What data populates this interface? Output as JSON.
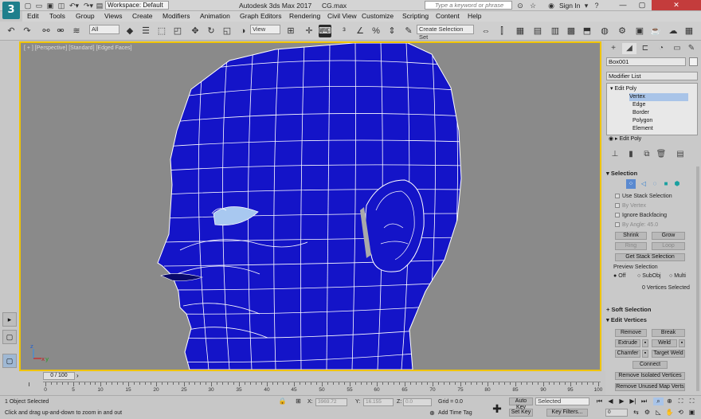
{
  "app": {
    "logo": "3",
    "title": "Autodesk 3ds Max 2017",
    "file": "CG.max",
    "workspace": "Workspace: Default",
    "search_placeholder": "Type a keyword or phrase",
    "sign_in": "Sign In"
  },
  "menu": [
    "Edit",
    "Tools",
    "Group",
    "Views",
    "Create",
    "Modifiers",
    "Animation",
    "Graph Editors",
    "Rendering",
    "Civil View",
    "Customize",
    "Scripting",
    "Content",
    "Help"
  ],
  "toolbar": {
    "filter": "All",
    "refcoord": "View",
    "selset": "Create Selection Set"
  },
  "viewport": {
    "label": "[ + ] [Perspective] [Standard] [Edged Faces]",
    "axis_x": "x",
    "axis_y": "y",
    "axis_z": "z"
  },
  "command_panel": {
    "object_name": "Box001",
    "modifier_list": "Modifier List",
    "stack": [
      {
        "label": "Edit Poly",
        "level": 0
      },
      {
        "label": "Vertex",
        "level": 1
      },
      {
        "label": "Edge",
        "level": 1
      },
      {
        "label": "Border",
        "level": 1
      },
      {
        "label": "Polygon",
        "level": 1
      },
      {
        "label": "Element",
        "level": 1
      },
      {
        "label": "Edit Poly",
        "level": 0
      }
    ],
    "selection": {
      "title": "Selection",
      "use_stack": "Use Stack Selection",
      "by_vertex": "By Vertex",
      "ignore_backfacing": "Ignore Backfacing",
      "by_angle": "By Angle:",
      "angle": "45.0",
      "shrink": "Shrink",
      "grow": "Grow",
      "ring": "Ring",
      "loop": "Loop",
      "get_stack": "Get Stack Selection",
      "preview": "Preview Selection",
      "off": "Off",
      "subobj": "SubObj",
      "multi": "Multi",
      "count": "0 Vertices Selected"
    },
    "soft_selection": "Soft Selection",
    "edit_vertices": {
      "title": "Edit Vertices",
      "remove": "Remove",
      "break": "Break",
      "extrude": "Extrude",
      "weld": "Weld",
      "chamfer": "Chamfer",
      "target_weld": "Target Weld",
      "connect": "Connect",
      "remove_isolated": "Remove Isolated Vertices",
      "remove_unused": "Remove Unused Map Verts"
    }
  },
  "timeline": {
    "frame": "0 / 100",
    "ticks": [
      "0",
      "5",
      "10",
      "15",
      "20",
      "25",
      "30",
      "35",
      "40",
      "45",
      "50",
      "55",
      "60",
      "65",
      "70",
      "75",
      "80",
      "85",
      "90",
      "95",
      "100"
    ]
  },
  "status": {
    "selected": "1 Object Selected",
    "prompt": "Click and drag up-and-down to zoom in and out",
    "x_label": "X:",
    "x": "3969.72",
    "y_label": "Y:",
    "y": "16.155",
    "z_label": "Z:",
    "z": "0.0",
    "grid": "Grid = 0.0",
    "add_time_tag": "Add Time Tag",
    "auto_key": "Auto Key",
    "selected_dd": "Selected",
    "set_key": "Set Key",
    "key_filters": "Key Filters...",
    "frame_field": "0"
  },
  "colors": {
    "mesh": "#1414c8",
    "wire": "#ffffff",
    "viewport_border": "#f0c400",
    "selection": "#a8c8f0"
  }
}
